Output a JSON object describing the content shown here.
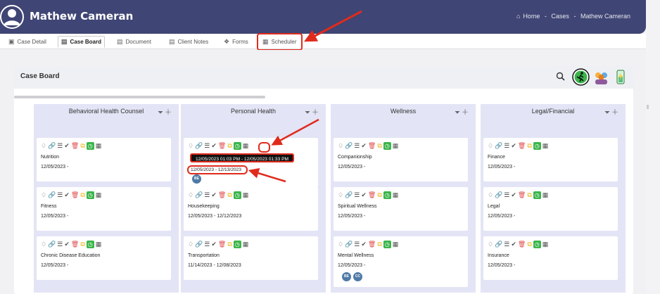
{
  "header": {
    "title": "Mathew Cameran",
    "breadcrumb": {
      "home": "Home",
      "sep": "-",
      "cases": "Cases",
      "current": "Mathew Cameran"
    }
  },
  "tabs": [
    {
      "label": "Case Detail",
      "icon": "briefcase-icon"
    },
    {
      "label": "Case Board",
      "icon": "clipboard-icon"
    },
    {
      "label": "Document",
      "icon": "document-icon"
    },
    {
      "label": "Client Notes",
      "icon": "notes-icon"
    },
    {
      "label": "Forms",
      "icon": "puzzle-icon"
    },
    {
      "label": "Scheduler",
      "icon": "calendar-icon"
    }
  ],
  "board": {
    "title": "Case Board"
  },
  "columns": [
    {
      "name": "Behavioral Health Counsel",
      "cards": [
        {
          "name": "Nutrition",
          "date": "12/05/2023 -"
        },
        {
          "name": "Fitness",
          "date": "12/05/2023 -"
        },
        {
          "name": "Chronic Disease Education",
          "date": "12/05/2023 -"
        }
      ]
    },
    {
      "name": "Personal Health",
      "cards": [
        {
          "name": "",
          "date": "12/05/2023 - 12/13/2023",
          "tooltip": "12/05/2023 01:03 PM - 12/05/2023 01:33 PM",
          "badges": [
            "BE"
          ]
        },
        {
          "name": "Housekeeping",
          "date": "12/05/2023 - 12/12/2023"
        },
        {
          "name": "Transportation",
          "date": "11/14/2023 - 12/08/2023"
        }
      ]
    },
    {
      "name": "Wellness",
      "cards": [
        {
          "name": "Companionship",
          "date": "12/05/2023 -"
        },
        {
          "name": "Spiritual Wellness",
          "date": "12/05/2023 -"
        },
        {
          "name": "Mental Wellness",
          "date": "12/05/2023 -",
          "badges": [
            "BE",
            "CC"
          ]
        }
      ]
    },
    {
      "name": "Legal/Financial",
      "cards": [
        {
          "name": "Finance",
          "date": "12/05/2023 -"
        },
        {
          "name": "Legal",
          "date": "12/05/2023 -"
        },
        {
          "name": "Insurance",
          "date": "12/05/2023 -"
        }
      ]
    }
  ],
  "colors": {
    "header": "#3f4574",
    "column": "#e3e4f5",
    "highlight": "#e02b1c",
    "clock": "#3ab54a"
  }
}
